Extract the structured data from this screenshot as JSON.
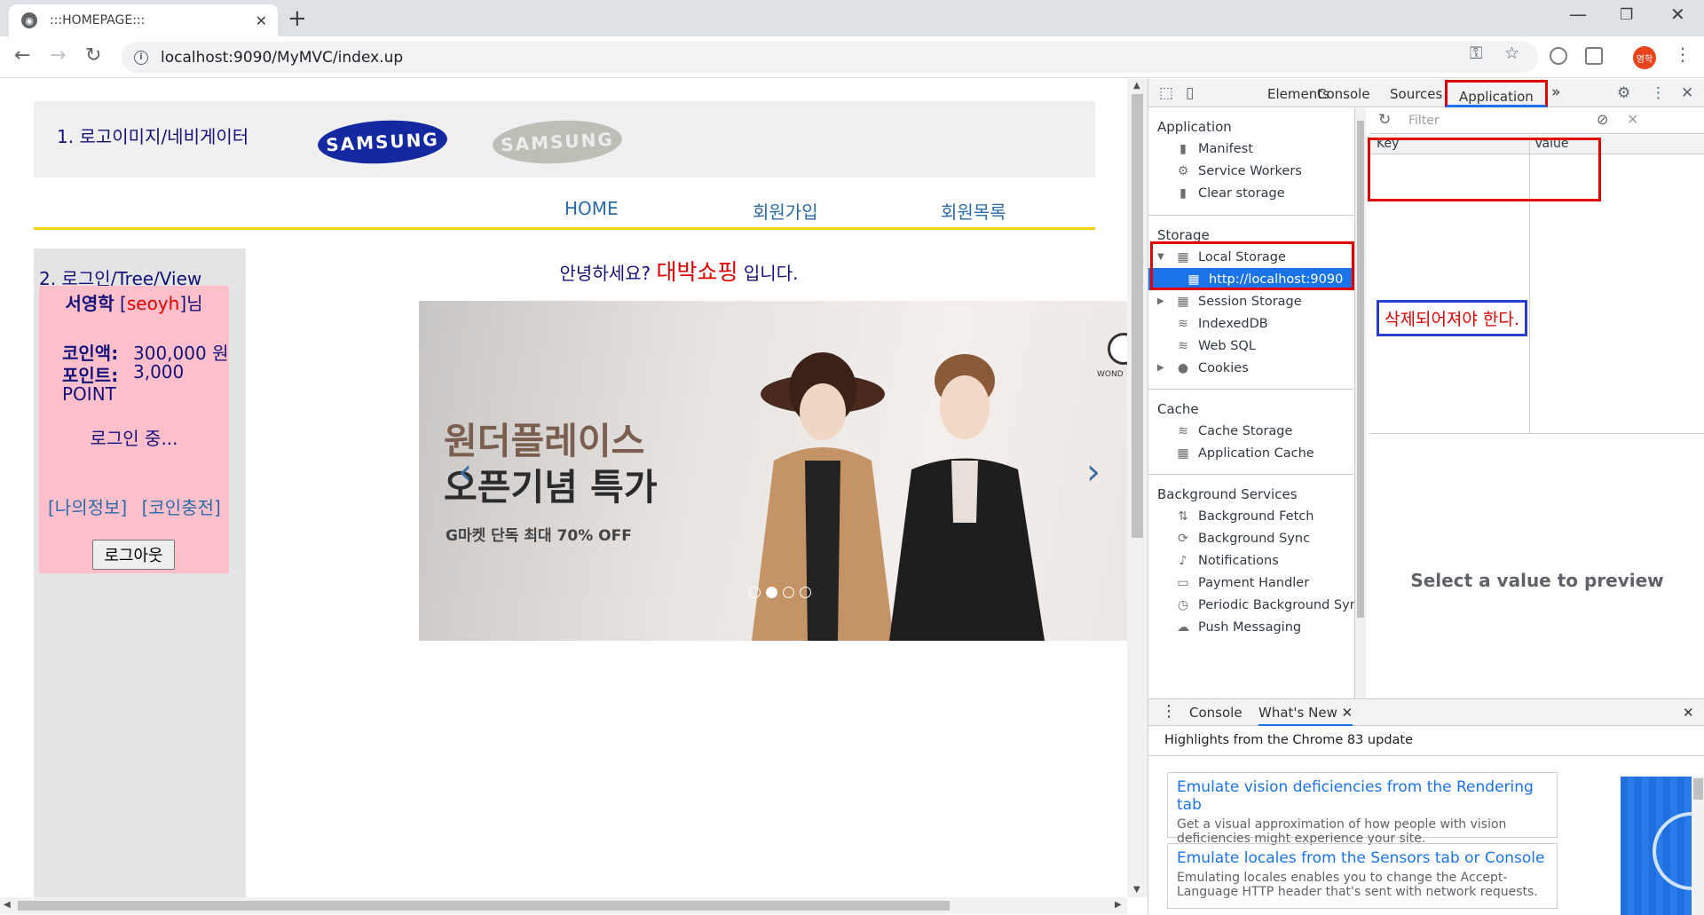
{
  "browser": {
    "tab_title": ":::HOMEPAGE:::",
    "url": "localhost:9090/MyMVC/index.up",
    "profile_initials": "영학"
  },
  "page": {
    "header_label": "1. 로고이미지/네비게이터",
    "logo_text": "SAMSUNG",
    "nav": [
      "HOME",
      "회원가입",
      "회원목록"
    ],
    "sidebar_title": "2. 로그인/Tree/View",
    "login": {
      "name": "서영학",
      "id_open": "[",
      "id": "seoyh",
      "id_close": "]님",
      "coin_label": "코인액:",
      "coin_value": "300,000 원",
      "point_label": "포인트:",
      "point_value": "3,000",
      "point_unit": "POINT",
      "status": "로그인 중...",
      "links": "[나의정보] [코인충전]",
      "logout": "로그아웃"
    },
    "greeting_pre": "안녕하세요? ",
    "greeting_shop": "대박쇼핑",
    "greeting_post": " 입니다.",
    "banner": {
      "line1": "원더플레이스",
      "line2": "오픈기념 특가",
      "line3": "G마켓 단독 최대 70% OFF",
      "brand_mark": "WOND",
      "active_slide": 2,
      "slide_count": 4
    }
  },
  "devtools": {
    "tabs": [
      "Elements",
      "Console",
      "Sources",
      "Application"
    ],
    "active_tab": "Application",
    "more_tabs": "»",
    "sidebar": {
      "application_header": "Application",
      "application_items": [
        "Manifest",
        "Service Workers",
        "Clear storage"
      ],
      "storage_header": "Storage",
      "local_storage": "Local Storage",
      "local_storage_origin": "http://localhost:9090",
      "storage_items": [
        "Session Storage",
        "IndexedDB",
        "Web SQL",
        "Cookies"
      ],
      "cache_header": "Cache",
      "cache_items": [
        "Cache Storage",
        "Application Cache"
      ],
      "bg_header": "Background Services",
      "bg_items": [
        "Background Fetch",
        "Background Sync",
        "Notifications",
        "Payment Handler",
        "Periodic Background Sync",
        "Push Messaging"
      ]
    },
    "filter_placeholder": "Filter",
    "key_header": "Key",
    "value_header": "Value",
    "annotation": "삭제되어져야 한다.",
    "preview_text": "Select a value to preview",
    "drawer": {
      "tabs": [
        "Console",
        "What's New"
      ],
      "active": "What's New",
      "highlight": "Highlights from the Chrome 83 update",
      "cards": [
        {
          "title": "Emulate vision deficiencies from the Rendering tab",
          "desc": "Get a visual approximation of how people with vision deficiencies might experience your site."
        },
        {
          "title": "Emulate locales from the Sensors tab or Console",
          "desc": "Emulating locales enables you to change the Accept-Language HTTP header that's sent with network requests."
        }
      ]
    }
  }
}
